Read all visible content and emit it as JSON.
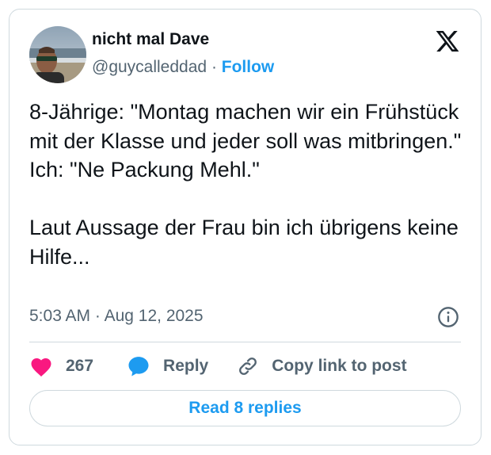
{
  "author": {
    "display_name": "nicht mal Dave",
    "handle": "@guycalleddad",
    "separator": "·",
    "follow_label": "Follow",
    "avatar_icon": "profile-photo-beach"
  },
  "post": {
    "text": "8-Jährige: \"Montag machen wir ein Frühstück mit der Klasse und jeder soll was mitbringen.\"\nIch: \"Ne Packung Mehl.\"\n\nLaut Aussage der Frau bin ich übrigens keine Hilfe...",
    "time": "5:03 AM",
    "separator": "·",
    "date": "Aug 12, 2025"
  },
  "actions": {
    "like_count": "267",
    "reply_label": "Reply",
    "copy_label": "Copy link to post"
  },
  "footer": {
    "read_replies_label": "Read 8 replies"
  },
  "colors": {
    "accent": "#1d9bf0",
    "like": "#f91880",
    "text": "#0f1419",
    "muted": "#536471",
    "border": "#cfd9de"
  }
}
